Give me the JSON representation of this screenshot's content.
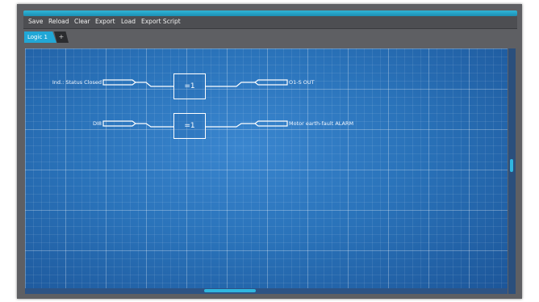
{
  "menu": {
    "save": "Save",
    "reload": "Reload",
    "clear": "Clear",
    "export": "Export",
    "load": "Load",
    "export_script": "Export Script"
  },
  "tabs": {
    "active": "Logic 1",
    "add": "+"
  },
  "diagram": {
    "row1": {
      "input_label": "Ind.: Status Closed",
      "gate_label": "=1",
      "output_label": "O1-S OUT"
    },
    "row2": {
      "input_label": "DI8",
      "gate_label": "=1",
      "output_label": "Motor earth-fault ALARM"
    }
  },
  "colors": {
    "accent": "#21a7d6",
    "canvas": "#1e5fa1",
    "frame": "#5e5f63"
  }
}
